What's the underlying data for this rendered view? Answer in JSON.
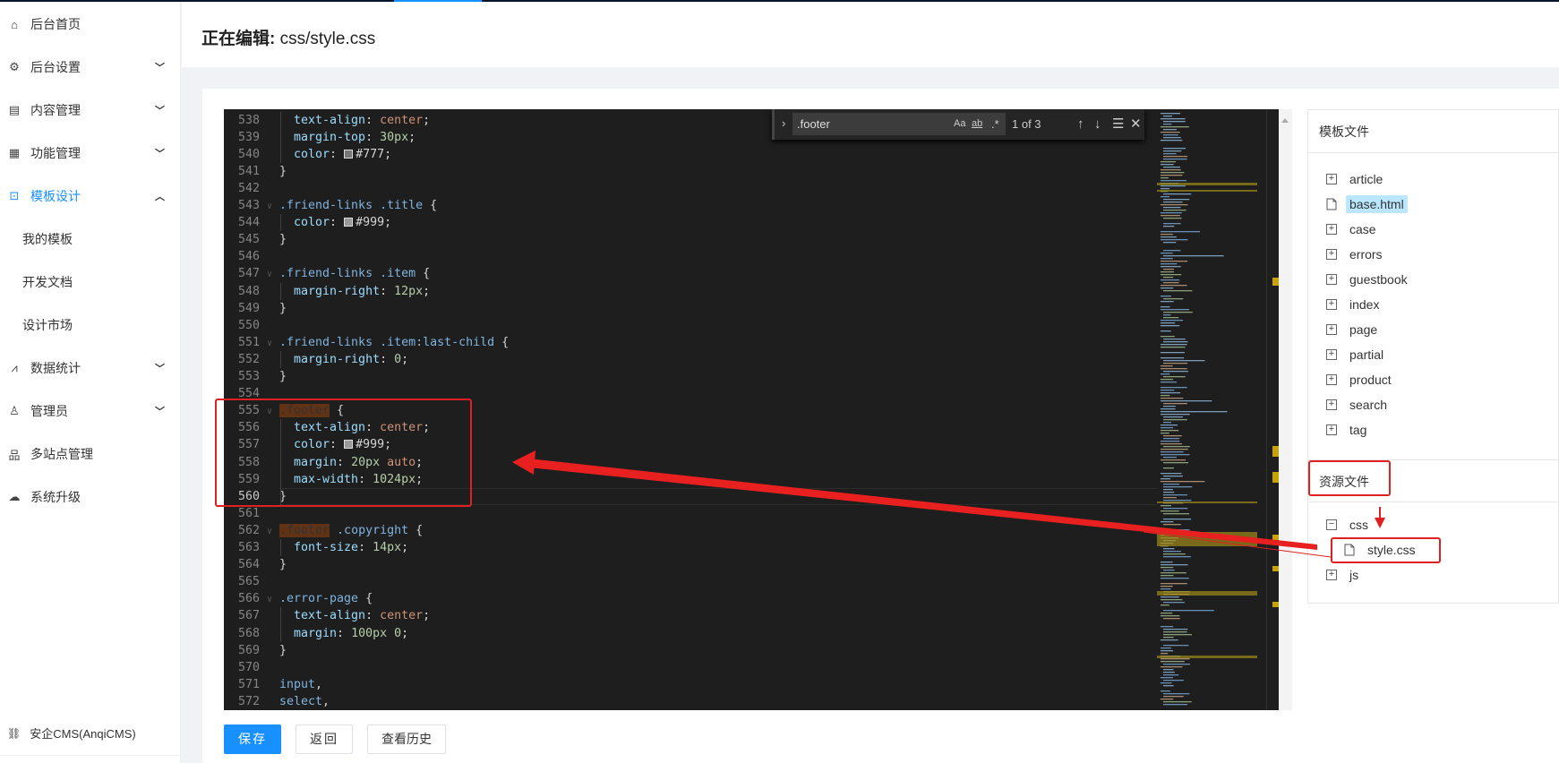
{
  "sidebar": {
    "items": [
      {
        "label": "后台首页",
        "icon": "home-icon",
        "glyph": "⌂",
        "chevron": ""
      },
      {
        "label": "后台设置",
        "icon": "gear-icon",
        "glyph": "⚙",
        "chevron": "⌄"
      },
      {
        "label": "内容管理",
        "icon": "document-icon",
        "glyph": "▤",
        "chevron": "⌄"
      },
      {
        "label": "功能管理",
        "icon": "grid-icon",
        "glyph": "▦",
        "chevron": "⌄"
      },
      {
        "label": "模板设计",
        "icon": "terminal-icon",
        "glyph": "⊡",
        "chevron": "⌃",
        "active": true
      },
      {
        "label": "我的模板",
        "sub": true
      },
      {
        "label": "开发文档",
        "sub": true
      },
      {
        "label": "设计市场",
        "sub": true
      },
      {
        "label": "数据统计",
        "icon": "chart-icon",
        "glyph": "⩘",
        "chevron": "⌄"
      },
      {
        "label": "管理员",
        "icon": "user-icon",
        "glyph": "♙",
        "chevron": "⌄"
      },
      {
        "label": "多站点管理",
        "icon": "sitemap-icon",
        "glyph": "品",
        "chevron": ""
      },
      {
        "label": "系统升级",
        "icon": "cloud-upgrade-icon",
        "glyph": "☁",
        "chevron": ""
      }
    ],
    "footer": {
      "label": "安企CMS(AnqiCMS)",
      "icon": "link-icon",
      "glyph": "🔗"
    }
  },
  "header": {
    "title_prefix": "正在编辑:",
    "title_file": "css/style.css"
  },
  "find_widget": {
    "query": ".footer",
    "match_case": "Aa",
    "whole_word": "ab",
    "regex": ".*",
    "count": "1 of 3"
  },
  "editor": {
    "current_line": 560,
    "lines": [
      {
        "n": 538,
        "t": [
          [
            "prop",
            "  text-align"
          ],
          [
            "punc",
            ": "
          ],
          [
            "kw",
            "center"
          ],
          [
            "punc",
            ";"
          ]
        ]
      },
      {
        "n": 539,
        "t": [
          [
            "prop",
            "  margin-top"
          ],
          [
            "punc",
            ": "
          ],
          [
            "num",
            "30px"
          ],
          [
            "punc",
            ";"
          ]
        ]
      },
      {
        "n": 540,
        "t": [
          [
            "prop",
            "  color"
          ],
          [
            "punc",
            ": "
          ],
          [
            "sw",
            "#777777"
          ],
          [
            "hex",
            "#777"
          ],
          [
            "punc",
            ";"
          ]
        ]
      },
      {
        "n": 541,
        "t": [
          [
            "punc",
            "}"
          ]
        ]
      },
      {
        "n": 542,
        "t": []
      },
      {
        "n": 543,
        "f": 1,
        "t": [
          [
            "sel",
            ".friend-links .title"
          ],
          [
            "punc",
            " {"
          ]
        ]
      },
      {
        "n": 544,
        "t": [
          [
            "prop",
            "  color"
          ],
          [
            "punc",
            ": "
          ],
          [
            "sw",
            "#999999"
          ],
          [
            "hex",
            "#999"
          ],
          [
            "punc",
            ";"
          ]
        ]
      },
      {
        "n": 545,
        "t": [
          [
            "punc",
            "}"
          ]
        ]
      },
      {
        "n": 546,
        "t": []
      },
      {
        "n": 547,
        "f": 1,
        "t": [
          [
            "sel",
            ".friend-links .item"
          ],
          [
            "punc",
            " {"
          ]
        ]
      },
      {
        "n": 548,
        "t": [
          [
            "prop",
            "  margin-right"
          ],
          [
            "punc",
            ": "
          ],
          [
            "num",
            "12px"
          ],
          [
            "punc",
            ";"
          ]
        ]
      },
      {
        "n": 549,
        "t": [
          [
            "punc",
            "}"
          ]
        ]
      },
      {
        "n": 550,
        "t": []
      },
      {
        "n": 551,
        "f": 1,
        "t": [
          [
            "sel",
            ".friend-links .item:last-child"
          ],
          [
            "punc",
            " {"
          ]
        ]
      },
      {
        "n": 552,
        "t": [
          [
            "prop",
            "  margin-right"
          ],
          [
            "punc",
            ": "
          ],
          [
            "num",
            "0"
          ],
          [
            "punc",
            ";"
          ]
        ]
      },
      {
        "n": 553,
        "t": [
          [
            "punc",
            "}"
          ]
        ]
      },
      {
        "n": 554,
        "t": []
      },
      {
        "n": 555,
        "f": 1,
        "t": [
          [
            "match",
            ".footer"
          ],
          [
            "punc",
            " {"
          ]
        ]
      },
      {
        "n": 556,
        "t": [
          [
            "prop",
            "  text-align"
          ],
          [
            "punc",
            ": "
          ],
          [
            "kw",
            "center"
          ],
          [
            "punc",
            ";"
          ]
        ]
      },
      {
        "n": 557,
        "t": [
          [
            "prop",
            "  color"
          ],
          [
            "punc",
            ": "
          ],
          [
            "sw",
            "#999999"
          ],
          [
            "hex",
            "#999"
          ],
          [
            "punc",
            ";"
          ]
        ]
      },
      {
        "n": 558,
        "t": [
          [
            "prop",
            "  margin"
          ],
          [
            "punc",
            ": "
          ],
          [
            "num",
            "20px "
          ],
          [
            "kw",
            "auto"
          ],
          [
            "punc",
            ";"
          ]
        ]
      },
      {
        "n": 559,
        "t": [
          [
            "prop",
            "  max-width"
          ],
          [
            "punc",
            ": "
          ],
          [
            "num",
            "1024px"
          ],
          [
            "punc",
            ";"
          ]
        ]
      },
      {
        "n": 560,
        "t": [
          [
            "punc",
            "}"
          ]
        ]
      },
      {
        "n": 561,
        "t": []
      },
      {
        "n": 562,
        "f": 1,
        "t": [
          [
            "match",
            ".footer"
          ],
          [
            "sel",
            " .copyright"
          ],
          [
            "punc",
            " {"
          ]
        ]
      },
      {
        "n": 563,
        "t": [
          [
            "prop",
            "  font-size"
          ],
          [
            "punc",
            ": "
          ],
          [
            "num",
            "14px"
          ],
          [
            "punc",
            ";"
          ]
        ]
      },
      {
        "n": 564,
        "t": [
          [
            "punc",
            "}"
          ]
        ]
      },
      {
        "n": 565,
        "t": []
      },
      {
        "n": 566,
        "f": 1,
        "t": [
          [
            "sel",
            ".error-page"
          ],
          [
            "punc",
            " {"
          ]
        ]
      },
      {
        "n": 567,
        "t": [
          [
            "prop",
            "  text-align"
          ],
          [
            "punc",
            ": "
          ],
          [
            "kw",
            "center"
          ],
          [
            "punc",
            ";"
          ]
        ]
      },
      {
        "n": 568,
        "t": [
          [
            "prop",
            "  margin"
          ],
          [
            "punc",
            ": "
          ],
          [
            "num",
            "100px 0"
          ],
          [
            "punc",
            ";"
          ]
        ]
      },
      {
        "n": 569,
        "t": [
          [
            "punc",
            "}"
          ]
        ]
      },
      {
        "n": 570,
        "t": []
      },
      {
        "n": 571,
        "t": [
          [
            "sel",
            "input"
          ],
          [
            "punc",
            ","
          ]
        ]
      },
      {
        "n": 572,
        "t": [
          [
            "sel",
            "select"
          ],
          [
            "punc",
            ","
          ]
        ]
      }
    ]
  },
  "template_files": {
    "title": "模板文件",
    "items": [
      {
        "label": "article",
        "type": "folder"
      },
      {
        "label": "base.html",
        "type": "file",
        "selected": true
      },
      {
        "label": "case",
        "type": "folder"
      },
      {
        "label": "errors",
        "type": "folder"
      },
      {
        "label": "guestbook",
        "type": "folder"
      },
      {
        "label": "index",
        "type": "folder"
      },
      {
        "label": "page",
        "type": "folder"
      },
      {
        "label": "partial",
        "type": "folder"
      },
      {
        "label": "product",
        "type": "folder"
      },
      {
        "label": "search",
        "type": "folder"
      },
      {
        "label": "tag",
        "type": "folder"
      }
    ]
  },
  "resource_files": {
    "title": "资源文件",
    "items": [
      {
        "label": "css",
        "type": "folder-open"
      },
      {
        "label": "style.css",
        "type": "file",
        "indent": true
      },
      {
        "label": "js",
        "type": "folder"
      }
    ]
  },
  "actions": {
    "save": "保存",
    "back": "返回",
    "history": "查看历史"
  },
  "colors": {
    "accent": "#1890ff",
    "annotation": "#e02020",
    "editor_bg": "#1e1e1e"
  }
}
